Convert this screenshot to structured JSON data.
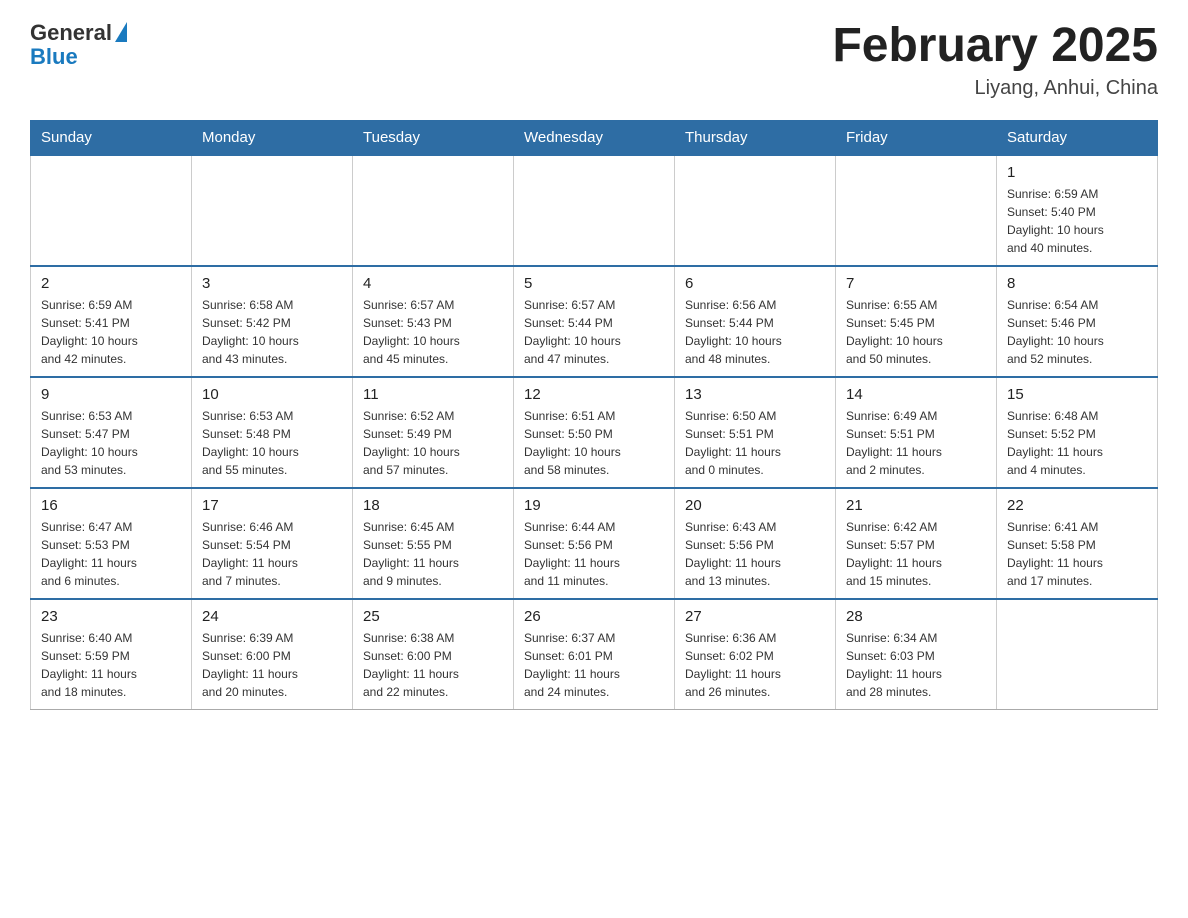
{
  "header": {
    "logo_general": "General",
    "logo_blue": "Blue",
    "title": "February 2025",
    "location": "Liyang, Anhui, China"
  },
  "weekdays": [
    "Sunday",
    "Monday",
    "Tuesday",
    "Wednesday",
    "Thursday",
    "Friday",
    "Saturday"
  ],
  "weeks": [
    [
      {
        "day": "",
        "info": ""
      },
      {
        "day": "",
        "info": ""
      },
      {
        "day": "",
        "info": ""
      },
      {
        "day": "",
        "info": ""
      },
      {
        "day": "",
        "info": ""
      },
      {
        "day": "",
        "info": ""
      },
      {
        "day": "1",
        "info": "Sunrise: 6:59 AM\nSunset: 5:40 PM\nDaylight: 10 hours\nand 40 minutes."
      }
    ],
    [
      {
        "day": "2",
        "info": "Sunrise: 6:59 AM\nSunset: 5:41 PM\nDaylight: 10 hours\nand 42 minutes."
      },
      {
        "day": "3",
        "info": "Sunrise: 6:58 AM\nSunset: 5:42 PM\nDaylight: 10 hours\nand 43 minutes."
      },
      {
        "day": "4",
        "info": "Sunrise: 6:57 AM\nSunset: 5:43 PM\nDaylight: 10 hours\nand 45 minutes."
      },
      {
        "day": "5",
        "info": "Sunrise: 6:57 AM\nSunset: 5:44 PM\nDaylight: 10 hours\nand 47 minutes."
      },
      {
        "day": "6",
        "info": "Sunrise: 6:56 AM\nSunset: 5:44 PM\nDaylight: 10 hours\nand 48 minutes."
      },
      {
        "day": "7",
        "info": "Sunrise: 6:55 AM\nSunset: 5:45 PM\nDaylight: 10 hours\nand 50 minutes."
      },
      {
        "day": "8",
        "info": "Sunrise: 6:54 AM\nSunset: 5:46 PM\nDaylight: 10 hours\nand 52 minutes."
      }
    ],
    [
      {
        "day": "9",
        "info": "Sunrise: 6:53 AM\nSunset: 5:47 PM\nDaylight: 10 hours\nand 53 minutes."
      },
      {
        "day": "10",
        "info": "Sunrise: 6:53 AM\nSunset: 5:48 PM\nDaylight: 10 hours\nand 55 minutes."
      },
      {
        "day": "11",
        "info": "Sunrise: 6:52 AM\nSunset: 5:49 PM\nDaylight: 10 hours\nand 57 minutes."
      },
      {
        "day": "12",
        "info": "Sunrise: 6:51 AM\nSunset: 5:50 PM\nDaylight: 10 hours\nand 58 minutes."
      },
      {
        "day": "13",
        "info": "Sunrise: 6:50 AM\nSunset: 5:51 PM\nDaylight: 11 hours\nand 0 minutes."
      },
      {
        "day": "14",
        "info": "Sunrise: 6:49 AM\nSunset: 5:51 PM\nDaylight: 11 hours\nand 2 minutes."
      },
      {
        "day": "15",
        "info": "Sunrise: 6:48 AM\nSunset: 5:52 PM\nDaylight: 11 hours\nand 4 minutes."
      }
    ],
    [
      {
        "day": "16",
        "info": "Sunrise: 6:47 AM\nSunset: 5:53 PM\nDaylight: 11 hours\nand 6 minutes."
      },
      {
        "day": "17",
        "info": "Sunrise: 6:46 AM\nSunset: 5:54 PM\nDaylight: 11 hours\nand 7 minutes."
      },
      {
        "day": "18",
        "info": "Sunrise: 6:45 AM\nSunset: 5:55 PM\nDaylight: 11 hours\nand 9 minutes."
      },
      {
        "day": "19",
        "info": "Sunrise: 6:44 AM\nSunset: 5:56 PM\nDaylight: 11 hours\nand 11 minutes."
      },
      {
        "day": "20",
        "info": "Sunrise: 6:43 AM\nSunset: 5:56 PM\nDaylight: 11 hours\nand 13 minutes."
      },
      {
        "day": "21",
        "info": "Sunrise: 6:42 AM\nSunset: 5:57 PM\nDaylight: 11 hours\nand 15 minutes."
      },
      {
        "day": "22",
        "info": "Sunrise: 6:41 AM\nSunset: 5:58 PM\nDaylight: 11 hours\nand 17 minutes."
      }
    ],
    [
      {
        "day": "23",
        "info": "Sunrise: 6:40 AM\nSunset: 5:59 PM\nDaylight: 11 hours\nand 18 minutes."
      },
      {
        "day": "24",
        "info": "Sunrise: 6:39 AM\nSunset: 6:00 PM\nDaylight: 11 hours\nand 20 minutes."
      },
      {
        "day": "25",
        "info": "Sunrise: 6:38 AM\nSunset: 6:00 PM\nDaylight: 11 hours\nand 22 minutes."
      },
      {
        "day": "26",
        "info": "Sunrise: 6:37 AM\nSunset: 6:01 PM\nDaylight: 11 hours\nand 24 minutes."
      },
      {
        "day": "27",
        "info": "Sunrise: 6:36 AM\nSunset: 6:02 PM\nDaylight: 11 hours\nand 26 minutes."
      },
      {
        "day": "28",
        "info": "Sunrise: 6:34 AM\nSunset: 6:03 PM\nDaylight: 11 hours\nand 28 minutes."
      },
      {
        "day": "",
        "info": ""
      }
    ]
  ]
}
